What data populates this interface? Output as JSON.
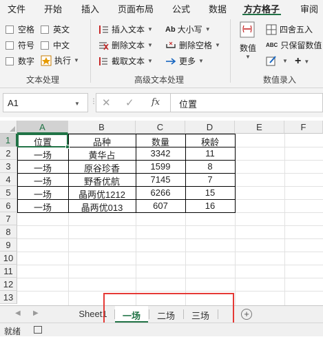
{
  "ribbon": {
    "tabs": [
      "文件",
      "开始",
      "插入",
      "页面布局",
      "公式",
      "数据",
      "方方格子",
      "审阅"
    ],
    "active_tab": "方方格子",
    "group_text": {
      "title": "文本处理",
      "checkboxes": [
        "空格",
        "英文",
        "符号",
        "中文",
        "数字"
      ],
      "execute_label": "执行"
    },
    "group_advanced": {
      "title": "高级文本处理",
      "insert_text": "插入文本",
      "delete_text": "删除文本",
      "extract_text": "截取文本",
      "case_label": "大小写",
      "case_prefix": "Ab",
      "delete_space": "删除空格",
      "more": "更多"
    },
    "group_value": {
      "title": "数值录入",
      "value_label": "数值",
      "round_label": "四舍五入",
      "keep_label": "只保留数值",
      "abc_prefix": "ABC"
    }
  },
  "formula_bar": {
    "name_box": "A1",
    "fx": "fx",
    "content": "位置"
  },
  "grid": {
    "columns": [
      "A",
      "B",
      "C",
      "D",
      "E",
      "F"
    ],
    "rows": [
      "1",
      "2",
      "3",
      "4",
      "5",
      "6",
      "7",
      "8",
      "9",
      "10",
      "11",
      "12",
      "13"
    ],
    "table": [
      [
        "位置",
        "品种",
        "数量",
        "秧龄"
      ],
      [
        "一场",
        "黄华占",
        "3342",
        "11"
      ],
      [
        "一场",
        "原谷珍香",
        "1599",
        "8"
      ],
      [
        "一场",
        "野香优航",
        "7145",
        "7"
      ],
      [
        "一场",
        "晶两优1212",
        "6266",
        "15"
      ],
      [
        "一场",
        "晶两优013",
        "607",
        "16"
      ]
    ]
  },
  "sheet_tabs": [
    "Sheet1",
    "一场",
    "二场",
    "三场"
  ],
  "active_sheet": "一场",
  "status": {
    "ready": "就绪"
  },
  "colors": {
    "accent": "#217346",
    "highlight": "#e53935"
  }
}
